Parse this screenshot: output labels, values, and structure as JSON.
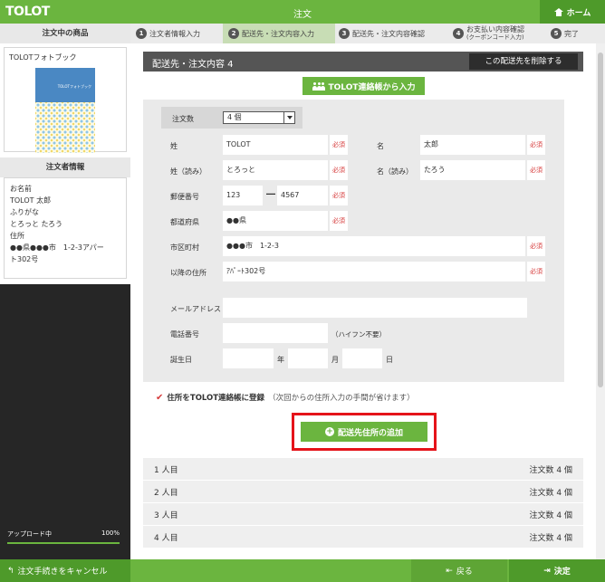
{
  "app": {
    "logo": "TOLOT",
    "title": "注文",
    "home_label": "ホーム"
  },
  "sidebar": {
    "product_heading": "注文中の商品",
    "product_name": "TOLOTフォトブック",
    "cover_text": "TOLOTフォトブック",
    "orderer_heading": "注文者情報",
    "orderer": {
      "name_label": "お名前",
      "name_value": "TOLOT 太郎",
      "kana_label": "ふりがな",
      "kana_value": "とろっと たろう",
      "address_label": "住所",
      "address_line1": "●●県●●●市　1-2-3アパー",
      "address_line2": "ト302号"
    },
    "upload_label": "アップロード中",
    "upload_percent": "100%",
    "upload_progress": 1.0
  },
  "steps": [
    {
      "num": "1",
      "label": "注文者情報入力",
      "active": false
    },
    {
      "num": "2",
      "label": "配送先・注文内容入力",
      "active": true
    },
    {
      "num": "3",
      "label": "配送先・注文内容確認",
      "active": false
    },
    {
      "num": "4",
      "label": "お支払い内容確認",
      "sublabel": "(クーポンコード入力)",
      "active": false
    },
    {
      "num": "5",
      "label": "完了",
      "active": false
    }
  ],
  "section": {
    "title": "配送先・注文内容 4",
    "delete_label": "この配送先を削除する",
    "contact_button": "TOLOT連絡帳から入力"
  },
  "form": {
    "qty_label": "注文数",
    "qty_value": "4 個",
    "required_tag": "必須",
    "last_name_label": "姓",
    "last_name_value": "TOLOT",
    "first_name_label": "名",
    "first_name_value": "太郎",
    "last_kana_label": "姓（読み）",
    "last_kana_value": "とろっと",
    "first_kana_label": "名（読み）",
    "first_kana_value": "たろう",
    "postal_label": "郵便番号",
    "postal1": "123",
    "postal_sep": "―",
    "postal2": "4567",
    "pref_label": "都道府県",
    "pref_value": "●●県",
    "city_label": "市区町村",
    "city_value": "●●●市　1-2-3",
    "addr2_label": "以降の住所",
    "addr2_value": "ｱﾊﾟｰﾄ302号",
    "email_label": "メールアドレス",
    "email_value": "",
    "phone_label": "電話番号",
    "phone_value": "",
    "phone_hint": "（ハイフン不要）",
    "birth_label": "誕生日",
    "birth_year": "",
    "birth_year_unit": "年",
    "birth_month": "",
    "birth_month_unit": "月",
    "birth_day": "",
    "birth_day_unit": "日"
  },
  "register": {
    "check_mark": "✔",
    "label": "住所をTOLOT連絡帳に登録",
    "note": "（次回からの住所入力の手間が省けます）"
  },
  "add_button": "配送先住所の追加",
  "recipients": [
    {
      "label": "1 人目",
      "qty": "注文数 4 個"
    },
    {
      "label": "2 人目",
      "qty": "注文数 4 個"
    },
    {
      "label": "3 人目",
      "qty": "注文数 4 個"
    },
    {
      "label": "4 人目",
      "qty": "注文数 4 個"
    }
  ],
  "bottom": {
    "cancel_label": "注文手続きをキャンセル",
    "back_label": "戻る",
    "next_label": "決定"
  },
  "colors": {
    "brand_green": "#6bb53f",
    "dark_green": "#4e9a2a",
    "highlight_red": "#e5131a",
    "required_red": "#d63a3a"
  }
}
